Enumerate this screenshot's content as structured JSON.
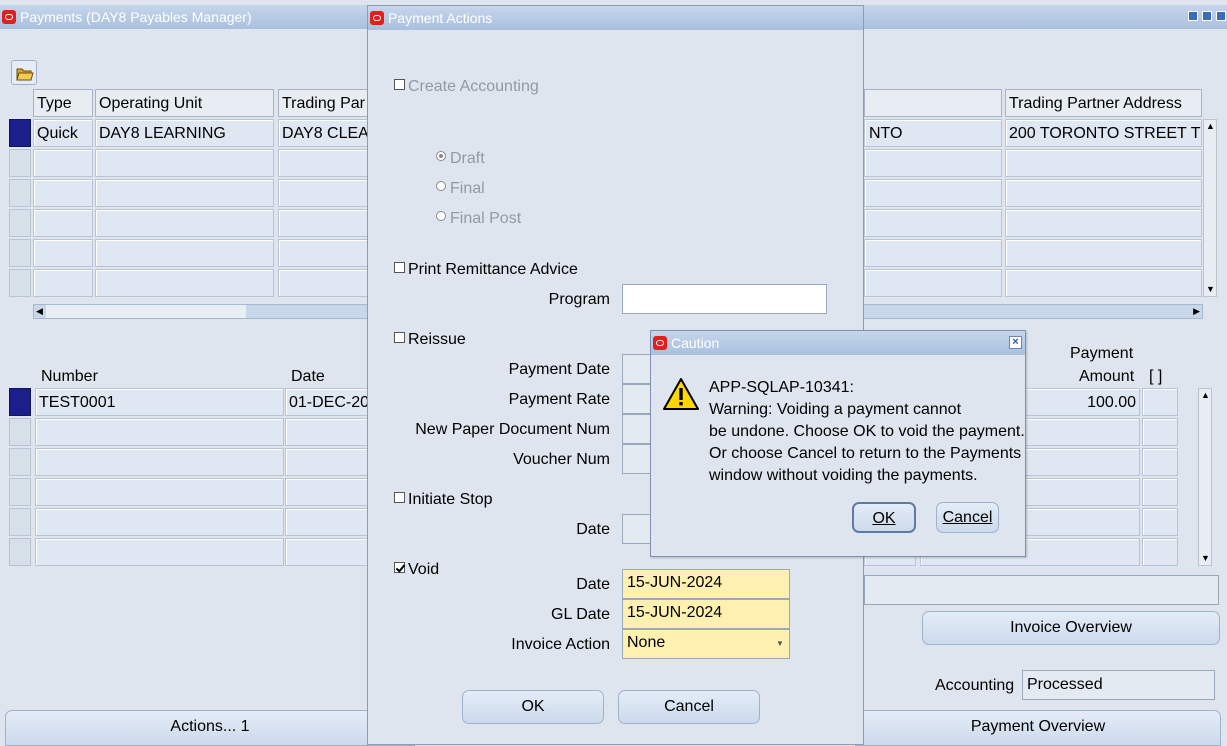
{
  "payments_window": {
    "title": "Payments (DAY8 Payables Manager)",
    "headers": [
      "Type",
      "Operating Unit",
      "Trading Par",
      "Trading Partner Address"
    ],
    "row1": {
      "type": "Quick",
      "operating_unit": "DAY8 LEARNING",
      "trading_partner": "DAY8 CLEA",
      "site_tail": "NTO",
      "address": "200 TORONTO STREET  T"
    },
    "lower_headers": {
      "number": "Number",
      "date": "Date",
      "payment": "Payment",
      "amount": "Amount",
      "flex": "[  ]"
    },
    "lower_row1": {
      "number": "TEST0001",
      "date": "01-DEC-20",
      "amount": "100.00"
    },
    "invoice_overview": "Invoice Overview",
    "accounting_label": "Accounting",
    "accounting_value": "Processed",
    "actions_button": "Actions... 1",
    "payment_overview": "Payment Overview"
  },
  "payment_actions": {
    "title": "Payment Actions",
    "create_accounting": "Create Accounting",
    "draft": "Draft",
    "final": "Final",
    "final_post": "Final Post",
    "print_remittance": "Print Remittance Advice",
    "program_label": "Program",
    "reissue": "Reissue",
    "payment_date_label": "Payment Date",
    "payment_rate_label": "Payment Rate",
    "new_paper_doc_label": "New Paper Document Num",
    "voucher_num_label": "Voucher Num",
    "initiate_stop": "Initiate Stop",
    "stop_date_label": "Date",
    "void": "Void",
    "void_date_label": "Date",
    "void_date": "15-JUN-2024",
    "gl_date_label": "GL Date",
    "gl_date": "15-JUN-2024",
    "invoice_action_label": "Invoice Action",
    "invoice_action": "None",
    "ok": "OK",
    "cancel": "Cancel"
  },
  "caution": {
    "title": "Caution",
    "code": "APP-SQLAP-10341:",
    "line1": "Warning: Voiding a payment cannot",
    "line2": "be undone. Choose OK to void the payment.",
    "line3": "Or choose Cancel to return to the Payments",
    "line4": "window without voiding the payments.",
    "ok": "OK",
    "cancel": "Cancel"
  },
  "colors": {
    "titlebar": "#a9c0de",
    "required_field": "#fdf0b0",
    "selected_record": "#1a1f8c",
    "oracle_red": "#e0201c"
  },
  "icons": [
    "oracle-logo-icon",
    "open-folder-icon",
    "warning-icon",
    "close-icon",
    "minimize-icon",
    "maximize-icon"
  ]
}
